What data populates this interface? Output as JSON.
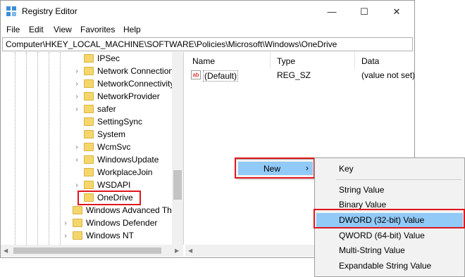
{
  "window": {
    "title": "Registry Editor",
    "minimize": "—",
    "maximize": "☐",
    "close": "✕"
  },
  "menubar": [
    "File",
    "Edit",
    "View",
    "Favorites",
    "Help"
  ],
  "address": "Computer\\HKEY_LOCAL_MACHINE\\SOFTWARE\\Policies\\Microsoft\\Windows\\OneDrive",
  "tree": {
    "items": [
      {
        "label": "IPSec",
        "expander": ""
      },
      {
        "label": "Network Connections",
        "expander": "›"
      },
      {
        "label": "NetworkConnectivityStatusIndicator",
        "expander": "›"
      },
      {
        "label": "NetworkProvider",
        "expander": "›"
      },
      {
        "label": "safer",
        "expander": "›"
      },
      {
        "label": "SettingSync",
        "expander": ""
      },
      {
        "label": "System",
        "expander": ""
      },
      {
        "label": "WcmSvc",
        "expander": "›"
      },
      {
        "label": "WindowsUpdate",
        "expander": "›"
      },
      {
        "label": "WorkplaceJoin",
        "expander": ""
      },
      {
        "label": "WSDAPI",
        "expander": "›"
      },
      {
        "label": "OneDrive",
        "expander": ""
      },
      {
        "label": "Windows Advanced Threat Protection",
        "expander": ""
      },
      {
        "label": "Windows Defender",
        "expander": "›"
      },
      {
        "label": "Windows NT",
        "expander": "›"
      }
    ]
  },
  "list": {
    "columns": [
      "Name",
      "Type",
      "Data"
    ],
    "rows": [
      {
        "icon": "ab",
        "name": "(Default)",
        "type": "REG_SZ",
        "data": "(value not set)"
      }
    ]
  },
  "context_menu": {
    "new_label": "New",
    "new_arrow": "›"
  },
  "submenu": {
    "items": [
      "Key",
      "String Value",
      "Binary Value",
      "DWORD (32-bit) Value",
      "QWORD (64-bit) Value",
      "Multi-String Value",
      "Expandable String Value"
    ]
  },
  "colors": {
    "highlight_box": "#e0161b",
    "menu_hover": "#91c9f7",
    "folder": "#f5d66b"
  }
}
